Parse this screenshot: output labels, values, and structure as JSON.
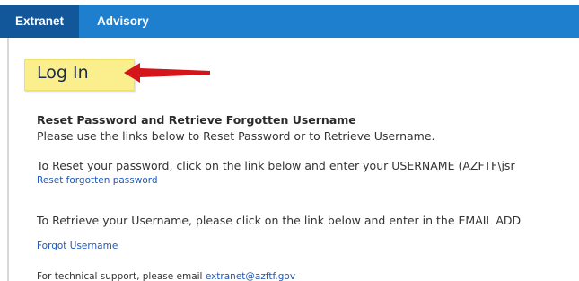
{
  "nav": {
    "tabs": [
      {
        "label": "Extranet",
        "active": true
      },
      {
        "label": "Advisory",
        "active": false
      }
    ]
  },
  "callout": {
    "label": "Log In",
    "arrow_icon": "red-arrow-left-icon"
  },
  "content": {
    "heading": "Reset Password and Retrieve Forgotten Username",
    "intro": "Please use the links below to Reset Password or to Retrieve Username.",
    "reset_instruction": "To Reset your password, click on the link below and enter your USERNAME (AZFTF\\jsr",
    "reset_link": "Reset forgotten password",
    "retrieve_instruction": "To Retrieve your Username, please click on the link below and enter in the EMAIL ADD",
    "forgot_link": "Forgot Username",
    "support_text": "For technical support, please email ",
    "support_email": "extranet@azftf.gov"
  },
  "colors": {
    "nav_bar": "#1d7fce",
    "active_tab": "#11579a",
    "callout_bg": "#fbef8d",
    "arrow": "#d4161c",
    "link": "#1f57b8"
  }
}
